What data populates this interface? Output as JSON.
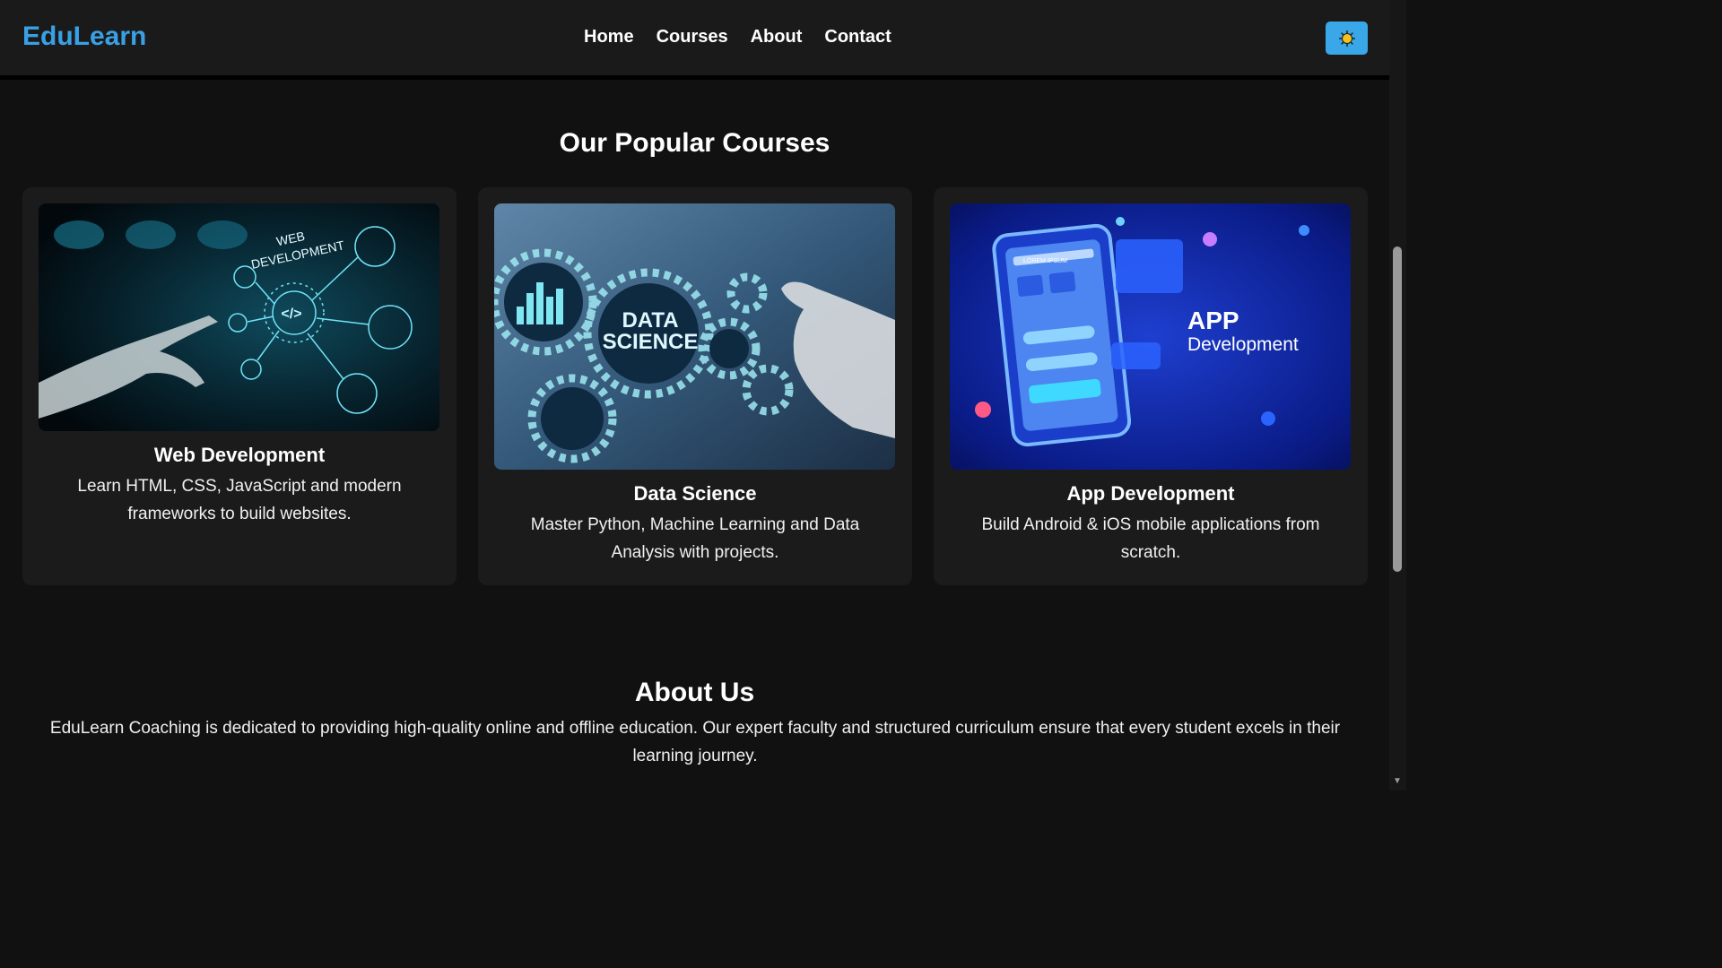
{
  "header": {
    "logo": "EduLearn",
    "nav": [
      "Home",
      "Courses",
      "About",
      "Contact"
    ],
    "theme_toggle_icon": "sun-icon"
  },
  "courses": {
    "title": "Our Popular Courses",
    "items": [
      {
        "title": "Web Development",
        "description_line1": "Learn HTML, CSS, JavaScript and modern",
        "description_line2": "frameworks to build websites.",
        "image_text_1": "WEB",
        "image_text_2": "DEVELOPMENT"
      },
      {
        "title": "Data Science",
        "description_line1": "Master Python, Machine Learning and Data",
        "description_line2": "Analysis with projects.",
        "image_text_1": "DATA",
        "image_text_2": "SCIENCE"
      },
      {
        "title": "App Development",
        "description_line1": "Build Android & iOS mobile applications from",
        "description_line2": "scratch.",
        "image_text_1": "APP",
        "image_text_2": "Development",
        "image_text_3": "LOREM IPSUM"
      }
    ]
  },
  "about": {
    "title": "About Us",
    "text_line1": "EduLearn Coaching is dedicated to providing high-quality online and offline education. Our expert faculty and structured curriculum ensure that every student excels in their",
    "text_line2": "learning journey."
  },
  "colors": {
    "accent": "#3aa0e6",
    "background": "#111111",
    "card": "#1b1b1b"
  }
}
